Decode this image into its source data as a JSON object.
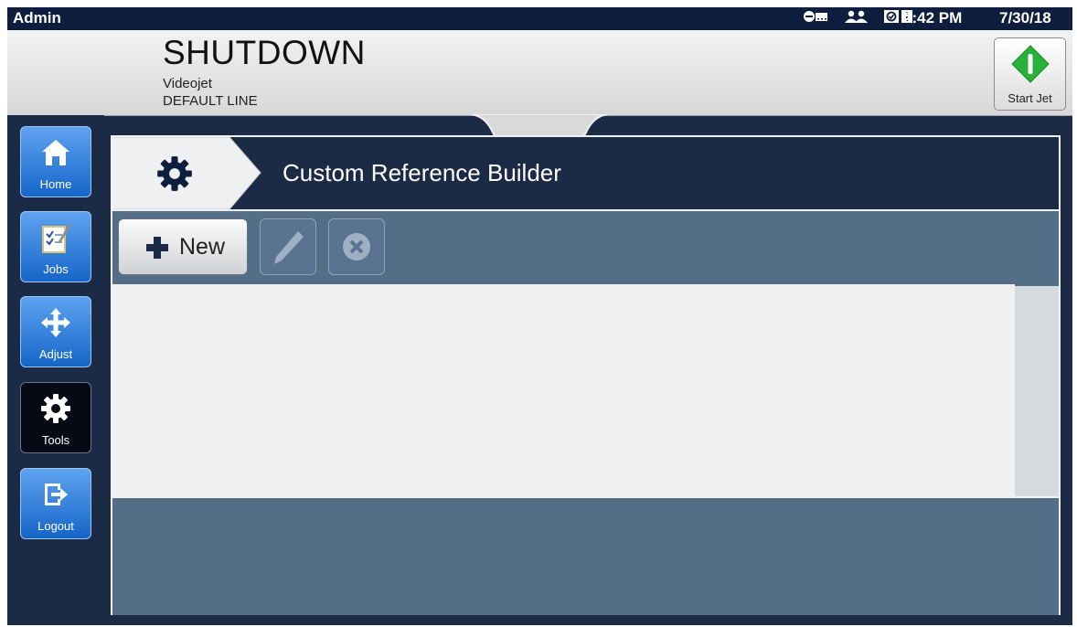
{
  "status_bar": {
    "user": "Admin",
    "time": "2:42 PM",
    "date": "7/30/18",
    "icons": [
      "connection-icon",
      "users-icon",
      "status-check-icon"
    ]
  },
  "header": {
    "state": "SHUTDOWN",
    "printer_name": "Videojet",
    "line_name": "DEFAULT LINE",
    "start_jet_label": "Start Jet"
  },
  "nav": {
    "items": [
      {
        "label": "Home",
        "icon": "home-icon"
      },
      {
        "label": "Jobs",
        "icon": "jobs-icon"
      },
      {
        "label": "Adjust",
        "icon": "adjust-icon"
      },
      {
        "label": "Tools",
        "icon": "gear-icon",
        "active": true
      },
      {
        "label": "Logout",
        "icon": "logout-icon"
      }
    ]
  },
  "page": {
    "title": "Custom Reference Builder",
    "breadcrumb_icon": "gear-icon"
  },
  "toolbar": {
    "new_label": "New",
    "edit_icon": "pencil-icon",
    "delete_icon": "delete-icon"
  },
  "colors": {
    "nav_bg": "#1b2a45",
    "nav_button": "#2c7be0",
    "panel_bg": "#556e88",
    "start_jet_green": "#2ab13a"
  }
}
